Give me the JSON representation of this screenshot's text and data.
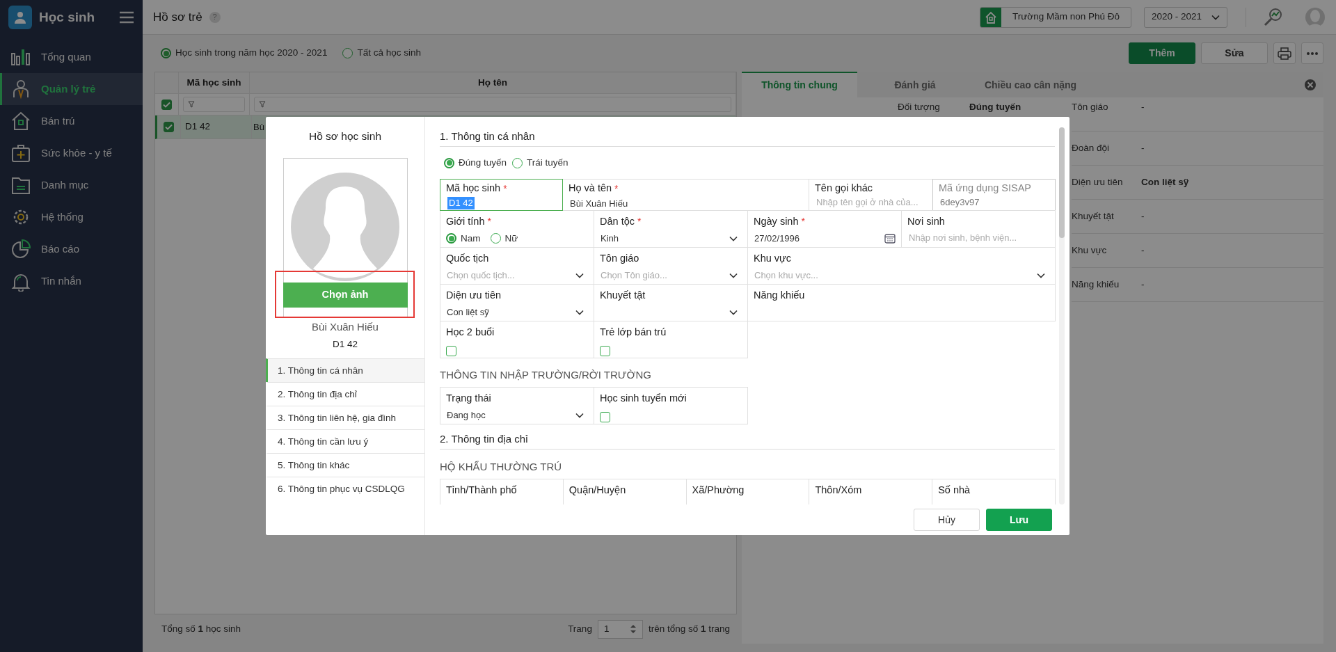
{
  "app": {
    "title": "Học sinh"
  },
  "sidebar": {
    "items": [
      {
        "label": "Tổng quan",
        "selected": false
      },
      {
        "label": "Quản lý trẻ",
        "selected": true
      },
      {
        "label": "Bán trú",
        "selected": false
      },
      {
        "label": "Sức khỏe - y tế",
        "selected": false
      },
      {
        "label": "Danh mục",
        "selected": false
      },
      {
        "label": "Hệ thống",
        "selected": false
      },
      {
        "label": "Báo cáo",
        "selected": false
      },
      {
        "label": "Tin nhắn",
        "selected": false
      }
    ]
  },
  "header": {
    "title": "Hồ sơ trẻ",
    "help": "?",
    "school": "Trường Mầm non Phú Đô",
    "year": "2020 - 2021"
  },
  "filter_options": [
    {
      "label": "Học sinh trong năm học 2020 - 2021",
      "selected": true
    },
    {
      "label": "Tất cả học sinh",
      "selected": false
    }
  ],
  "toolbar": {
    "buttons": [
      {
        "label": "Thêm",
        "kind": "primary"
      },
      {
        "label": "Sửa",
        "kind": "outline"
      }
    ]
  },
  "students_table": {
    "columns": [
      "Mã học sinh",
      "Họ tên"
    ],
    "select_all_checked": true,
    "rows": [
      {
        "checked": true,
        "selected": true,
        "cells": [
          "D1 42",
          "Bù"
        ]
      }
    ]
  },
  "table_footer": {
    "total": "Tổng số **1** học sinh",
    "page_label": "Trang",
    "page": "1",
    "page_total": "trên tổng số **1** trang"
  },
  "detail_panel": {
    "tabs": [
      {
        "label": "Thông tin chung",
        "selected": true
      },
      {
        "label": "Đánh giá",
        "selected": false
      },
      {
        "label": "Chiều cao cân nặng",
        "selected": false
      }
    ],
    "rows": [
      {
        "left": {
          "label": "Đối tượng",
          "value": "Đúng tuyến"
        },
        "right": {
          "label": "Tôn giáo",
          "value": "-"
        }
      },
      {
        "right": {
          "label": "Đoàn đội",
          "value": "-"
        }
      },
      {
        "right": {
          "label": "Diện ưu tiên",
          "value": "Con liệt sỹ"
        }
      },
      {
        "right": {
          "label": "Khuyết tật",
          "value": "-"
        }
      },
      {
        "right": {
          "label": "Khu vực",
          "value": "-"
        }
      },
      {
        "right": {
          "label": "Năng khiếu",
          "value": "-"
        }
      }
    ]
  },
  "modal": {
    "title": "Hồ sơ học sinh",
    "photo_button": "Chọn ảnh",
    "student_name": "Bùi Xuân Hiếu",
    "student_code": "D1 42",
    "nav": [
      {
        "label": "1. Thông tin cá nhân",
        "selected": true
      },
      {
        "label": "2. Thông tin địa chỉ",
        "selected": false
      },
      {
        "label": "3. Thông tin liên hệ, gia đình",
        "selected": false
      },
      {
        "label": "4. Thông tin cần lưu ý",
        "selected": false
      },
      {
        "label": "5. Thông tin khác",
        "selected": false
      },
      {
        "label": "6. Thông tin phục vụ CSDLQG",
        "selected": false
      }
    ],
    "sections": [
      {
        "title": "1. Thông tin cá nhân",
        "groups": [
          {
            "kind": "radios",
            "options": [
              {
                "label": "Đúng tuyến",
                "selected": true
              },
              {
                "label": "Trái tuyến",
                "selected": false
              }
            ]
          },
          {
            "kind": "top-grid",
            "fields": [
              {
                "kind": "text",
                "label": "Mã học sinh",
                "mark": "*",
                "value": "D1 42",
                "focused": true
              },
              {
                "kind": "text",
                "label": "Họ và tên",
                "mark": "*",
                "value": "Bùi Xuân Hiếu"
              },
              {
                "kind": "text",
                "label": "Tên gọi khác",
                "placeholder": "Nhập tên gọi ở nhà của..."
              },
              {
                "kind": "text",
                "label": "Mã ứng dụng SISAP",
                "value": "6dey3v97",
                "disabled": true
              }
            ]
          },
          {
            "kind": "grid",
            "fields": [
              {
                "kind": "radio",
                "label": "Giới tính",
                "mark": "*",
                "options": [
                  {
                    "label": "Nam",
                    "selected": true
                  },
                  {
                    "label": "Nữ",
                    "selected": false
                  }
                ]
              },
              {
                "kind": "select",
                "label": "Dân tộc",
                "mark": "*",
                "value": "Kinh"
              },
              {
                "kind": "date",
                "label": "Ngày sinh",
                "mark": "*",
                "value": "27/02/1996"
              },
              {
                "kind": "text",
                "label": "Nơi sinh",
                "placeholder": "Nhập nơi sinh, bệnh viện..."
              },
              {
                "kind": "select",
                "label": "Quốc tịch",
                "placeholder": "Chọn quốc tịch..."
              },
              {
                "kind": "select",
                "label": "Tôn giáo",
                "placeholder": "Chọn Tôn giáo..."
              },
              {
                "kind": "select",
                "label": "Khu vực",
                "placeholder": "Chọn khu vực...",
                "wide": true
              },
              {
                "kind": "select",
                "label": "Diện ưu tiên",
                "value": "Con liệt sỹ"
              },
              {
                "kind": "select",
                "label": "Khuyết tật"
              },
              {
                "kind": "area",
                "label": "Năng khiếu",
                "wide": true
              },
              {
                "kind": "checkbox",
                "label": "Học 2 buổi",
                "checked": false
              },
              {
                "kind": "checkbox",
                "label": "Trẻ lớp bán trú",
                "checked": false
              }
            ]
          },
          {
            "kind": "subheading",
            "text": "THÔNG TIN NHẬP TRƯỜNG/RỜI TRƯỜNG"
          },
          {
            "kind": "grid",
            "fields": [
              {
                "kind": "select",
                "label": "Trạng thái",
                "value": "Đang học"
              },
              {
                "kind": "checkbox",
                "label": "Học sinh tuyển mới",
                "checked": false
              }
            ]
          }
        ]
      },
      {
        "title": "2. Thông tin địa chỉ",
        "groups": [
          {
            "kind": "subheading",
            "text": "HỘ KHẨU THƯỜNG TRÚ"
          },
          {
            "kind": "grid5",
            "fields": [
              {
                "kind": "heading",
                "label": "Tỉnh/Thành phố"
              },
              {
                "kind": "heading",
                "label": "Quận/Huyện"
              },
              {
                "kind": "heading",
                "label": "Xã/Phường"
              },
              {
                "kind": "heading",
                "label": "Thôn/Xóm"
              },
              {
                "kind": "heading",
                "label": "Số nhà"
              }
            ]
          }
        ]
      }
    ],
    "buttons": [
      {
        "label": "Hủy",
        "kind": "outline"
      },
      {
        "label": "Lưu",
        "kind": "primary"
      }
    ]
  }
}
